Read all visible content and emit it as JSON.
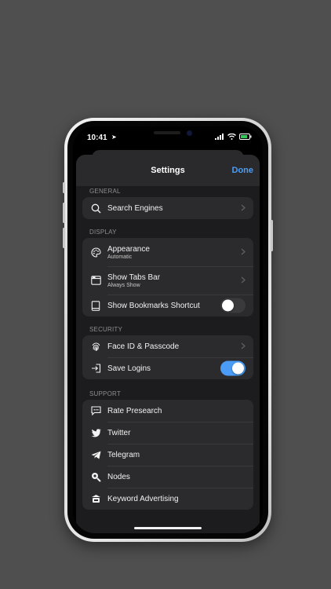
{
  "status_bar": {
    "time": "10:41"
  },
  "nav": {
    "title": "Settings",
    "done_label": "Done"
  },
  "sections": {
    "general": {
      "header": "GENERAL",
      "search_engines": "Search Engines"
    },
    "display": {
      "header": "DISPLAY",
      "appearance": {
        "label": "Appearance",
        "sub": "Automatic"
      },
      "tabs_bar": {
        "label": "Show Tabs Bar",
        "sub": "Always Show"
      },
      "bookmarks_shortcut": {
        "label": "Show Bookmarks Shortcut",
        "enabled": false
      }
    },
    "security": {
      "header": "SECURITY",
      "face_id": "Face ID & Passcode",
      "save_logins": {
        "label": "Save Logins",
        "enabled": true
      }
    },
    "support": {
      "header": "SUPPORT",
      "items": [
        "Rate Presearch",
        "Twitter",
        "Telegram",
        "Nodes",
        "Keyword Advertising"
      ]
    }
  },
  "colors": {
    "accent": "#4a9cf6",
    "background": "#1c1c1e",
    "row": "#2b2b2d"
  }
}
